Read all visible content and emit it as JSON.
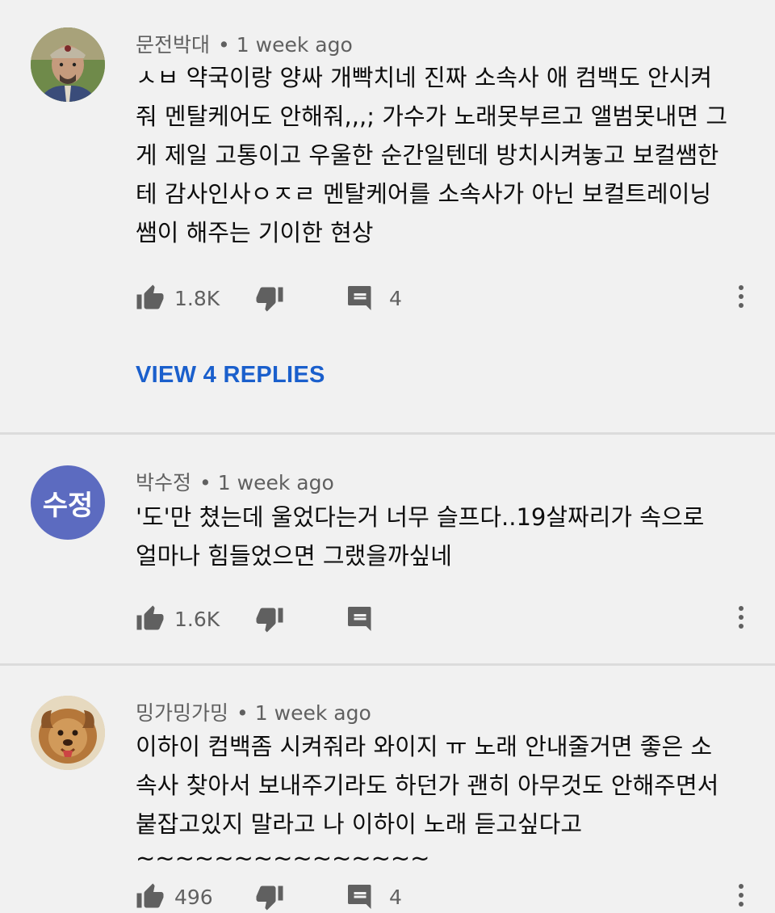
{
  "colors": {
    "background": "#f1f1f1",
    "link": "#1a5fcc",
    "meta": "#606060",
    "initials_avatar": "#5c6bc0"
  },
  "comments": [
    {
      "author": "문전박대",
      "time": "1 week ago",
      "lines": [
        "ㅅㅂ 약국이랑 양싸 개빡치네 진짜 소속사 애 컴백도 안시켜",
        "줘 멘탈케어도 안해줘,,,; 가수가 노래못부르고 앨범못내면 그",
        "게 제일 고통이고 우울한 순간일텐데 방치시켜놓고 보컬쌤한",
        "테 감사인사ㅇㅈㄹ 멘탈케어를 소속사가 아닌 보컬트레이닝",
        "쌤이 해주는 기이한 현상"
      ],
      "likes": "1.8K",
      "reply_count": "4",
      "view_replies": "VIEW 4 REPLIES"
    },
    {
      "author": "박수정",
      "time": "1 week ago",
      "avatar_initials": "수정",
      "lines": [
        "'도'만 쳤는데 울었다는거 너무 슬프다..19살짜리가 속으로",
        "얼마나 힘들었으면 그랬을까싶네"
      ],
      "likes": "1.6K",
      "reply_count": ""
    },
    {
      "author": "밍가밍가밍",
      "time": "1 week ago",
      "lines": [
        "이하이 컴백좀 시켜줘라 와이지 ㅠ 노래 안내줄거면 좋은 소",
        "속사 찾아서 보내주기라도 하던가 괜히 아무것도 안해주면서",
        "붙잡고있지 말라고 나 이하이 노래 듣고싶다고",
        "~~~~~~~~~~~~~~~"
      ],
      "likes": "496",
      "reply_count": "4"
    }
  ]
}
